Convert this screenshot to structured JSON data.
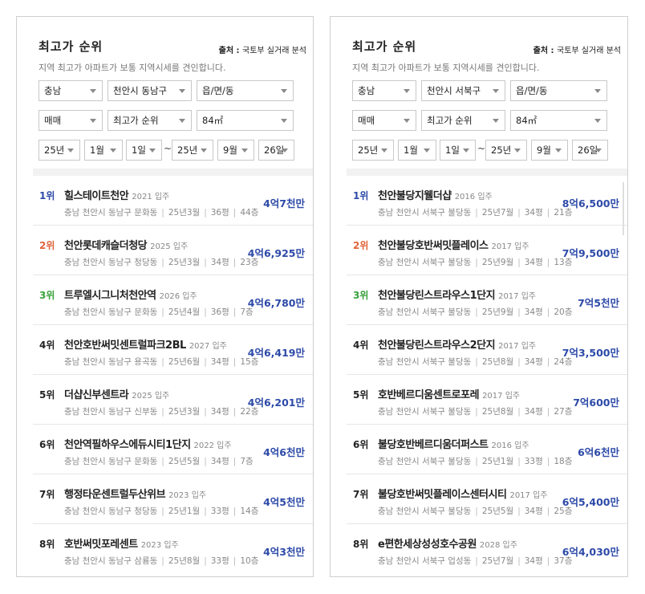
{
  "panels": [
    {
      "title": "최고가 순위",
      "source_label": "출처 : ",
      "source_name": "국토부 실거래 분석",
      "description": "지역 최고가 아파트가 보통 지역시세를 견인합니다.",
      "filters": {
        "region1": "충남",
        "region2": "천안시 동남구",
        "region3": "읍/면/동",
        "deal_type": "매매",
        "sort": "최고가 순위",
        "area": "84㎡",
        "from_year": "25년",
        "from_month": "1월",
        "from_day": "1일",
        "tilde": "~",
        "to_year": "25년",
        "to_month": "9월",
        "to_day": "26일"
      },
      "items": [
        {
          "rank": "1위",
          "name": "힐스테이트천안",
          "built": "2021 입주",
          "location": "충남 천안시 동남구 문화동",
          "date": "25년3월",
          "size": "36평",
          "floor": "44층",
          "price": "4억7천만"
        },
        {
          "rank": "2위",
          "name": "천안롯데캐슬더청당",
          "built": "2025 입주",
          "location": "충남 천안시 동남구 청당동",
          "date": "25년3월",
          "size": "34평",
          "floor": "23층",
          "price": "4억6,925만"
        },
        {
          "rank": "3위",
          "name": "트루엘시그니처천안역",
          "built": "2026 입주",
          "location": "충남 천안시 동남구 문화동",
          "date": "25년4월",
          "size": "36평",
          "floor": "7층",
          "price": "4억6,780만"
        },
        {
          "rank": "4위",
          "name": "천안호반써밋센트럴파크2BL",
          "built": "2027 입주",
          "location": "충남 천안시 동남구 용곡동",
          "date": "25년6월",
          "size": "34평",
          "floor": "15층",
          "price": "4억6,419만"
        },
        {
          "rank": "5위",
          "name": "더샵신부센트라",
          "built": "2025 입주",
          "location": "충남 천안시 동남구 신부동",
          "date": "25년3월",
          "size": "34평",
          "floor": "22층",
          "price": "4억6,201만"
        },
        {
          "rank": "6위",
          "name": "천안역필하우스에듀시티1단지",
          "built": "2022 입주",
          "location": "충남 천안시 동남구 문화동",
          "date": "25년5월",
          "size": "34평",
          "floor": "7층",
          "price": "4억6천만"
        },
        {
          "rank": "7위",
          "name": "행정타운센트럴두산위브",
          "built": "2023 입주",
          "location": "충남 천안시 동남구 청당동",
          "date": "25년1월",
          "size": "33평",
          "floor": "14층",
          "price": "4억5천만"
        },
        {
          "rank": "8위",
          "name": "호반써밋포레센트",
          "built": "2023 입주",
          "location": "충남 천안시 동남구 삼룡동",
          "date": "25년8월",
          "size": "33평",
          "floor": "10층",
          "price": "4억3천만"
        }
      ]
    },
    {
      "title": "최고가 순위",
      "source_label": "출처 : ",
      "source_name": "국토부 실거래 분석",
      "description": "지역 최고가 아파트가 보통 지역시세를 견인합니다.",
      "filters": {
        "region1": "충남",
        "region2": "천안시 서북구",
        "region3": "읍/면/동",
        "deal_type": "매매",
        "sort": "최고가 순위",
        "area": "84㎡",
        "from_year": "25년",
        "from_month": "1월",
        "from_day": "1일",
        "tilde": "~",
        "to_year": "25년",
        "to_month": "9월",
        "to_day": "26일"
      },
      "items": [
        {
          "rank": "1위",
          "name": "천안불당지웰더샵",
          "built": "2016 입주",
          "location": "충남 천안시 서북구 불당동",
          "date": "25년7월",
          "size": "34평",
          "floor": "21층",
          "price": "8억6,500만"
        },
        {
          "rank": "2위",
          "name": "천안불당호반써밋플레이스",
          "built": "2017 입주",
          "location": "충남 천안시 서북구 불당동",
          "date": "25년9월",
          "size": "34평",
          "floor": "13층",
          "price": "7억9,500만"
        },
        {
          "rank": "3위",
          "name": "천안불당린스트라우스1단지",
          "built": "2017 입주",
          "location": "충남 천안시 서북구 불당동",
          "date": "25년9월",
          "size": "34평",
          "floor": "20층",
          "price": "7억5천만"
        },
        {
          "rank": "4위",
          "name": "천안불당린스트라우스2단지",
          "built": "2017 입주",
          "location": "충남 천안시 서북구 불당동",
          "date": "25년8월",
          "size": "34평",
          "floor": "24층",
          "price": "7억3,500만"
        },
        {
          "rank": "5위",
          "name": "호반베르디움센트로포레",
          "built": "2017 입주",
          "location": "충남 천안시 서북구 불당동",
          "date": "25년8월",
          "size": "34평",
          "floor": "27층",
          "price": "7억600만"
        },
        {
          "rank": "6위",
          "name": "불당호반베르디움더퍼스트",
          "built": "2016 입주",
          "location": "충남 천안시 서북구 불당동",
          "date": "25년1월",
          "size": "33평",
          "floor": "18층",
          "price": "6억6천만"
        },
        {
          "rank": "7위",
          "name": "불당호반써밋플레이스센터시티",
          "built": "2017 입주",
          "location": "충남 천안시 서북구 불당동",
          "date": "25년5월",
          "size": "34평",
          "floor": "25층",
          "price": "6억5,400만"
        },
        {
          "rank": "8위",
          "name": "e편한세상성성호수공원",
          "built": "2028 입주",
          "location": "충남 천안시 서북구 업성동",
          "date": "25년7월",
          "size": "34평",
          "floor": "37층",
          "price": "6억4,030만"
        }
      ]
    }
  ]
}
